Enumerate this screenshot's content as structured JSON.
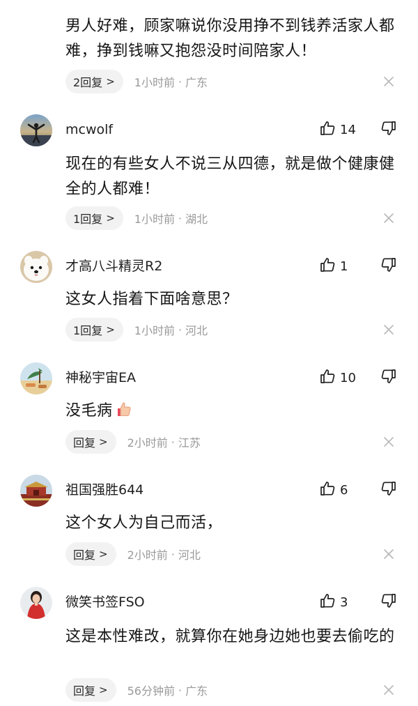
{
  "comments": [
    {
      "id": "c0",
      "username": "",
      "text": "男人好难，顾家嘛说你没用挣不到钱养活家人都难，挣到钱嘛又抱怨没时间陪家人！",
      "reply_label": "2回复",
      "time": "1小时前",
      "location": "广东",
      "likes": ""
    },
    {
      "id": "c1",
      "username": "mcwolf",
      "text": "现在的有些女人不说三从四德，就是做个健康健全的人都难！",
      "reply_label": "1回复",
      "time": "1小时前",
      "location": "湖北",
      "likes": "14",
      "avatar_icon": "person-at-sunset-avatar"
    },
    {
      "id": "c2",
      "username": "才高八斗精灵R2",
      "text": "这女人指着下面啥意思？",
      "reply_label": "1回复",
      "time": "1小时前",
      "location": "河北",
      "likes": "1",
      "avatar_icon": "white-dog-avatar"
    },
    {
      "id": "c3",
      "username": "神秘宇宙EA",
      "text": "没毛病",
      "reply_label": "回复",
      "time": "2小时前",
      "location": "江苏",
      "likes": "10",
      "avatar_icon": "beach-scene-avatar",
      "emoji": "thumbs-up-emoji"
    },
    {
      "id": "c4",
      "username": "祖国强胜644",
      "text": "这个女人为自己而活，",
      "reply_label": "回复",
      "time": "2小时前",
      "location": "河北",
      "likes": "6",
      "avatar_icon": "palace-gate-avatar"
    },
    {
      "id": "c5",
      "username": "微笑书签FSO",
      "text": "这是本性难改，就算你在她身边她也要去偷吃的",
      "reply_label": "回复",
      "time": "56分钟前",
      "location": "广东",
      "likes": "3",
      "avatar_icon": "woman-in-red-avatar"
    }
  ],
  "ui": {
    "reply_chevron": ">",
    "meta_separator": "·",
    "colors": {
      "text": "#161616",
      "meta": "#9a9a9a",
      "pill": "#f2f2f2"
    }
  }
}
